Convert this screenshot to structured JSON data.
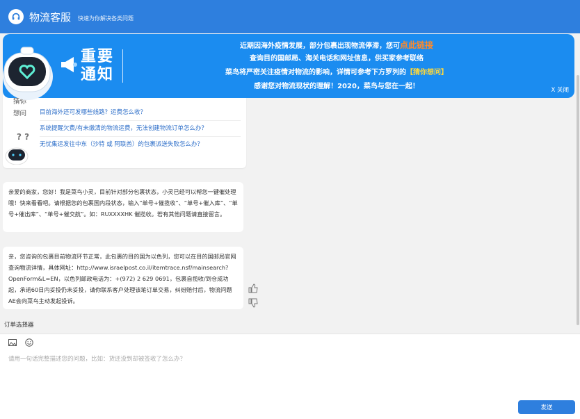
{
  "header": {
    "title": "物流客服",
    "subtitle": "快速为你解决各类问题"
  },
  "banner": {
    "heading_line1": "重要",
    "heading_line2": "通知",
    "line1_prefix": "近期因海外疫情发展，部分包裹出现物流停滞，您可",
    "line1_link": "点此链接",
    "line2": "查询目的国邮局、海关电话和网址信息，供买家参考联络",
    "line3_prefix": "菜鸟将严密关注疫情对物流的影响，详情可参考下方罗列的",
    "line3_link": "【猜你想问】",
    "line4": "感谢您对物流现状的理解！2020，菜鸟与您在一起！",
    "close_label": "X 关闭"
  },
  "faq": {
    "side_label_1": "猜你",
    "side_label_2": "想问",
    "questions": [
      "目前海外还可发哪些线路？运费怎么收？",
      "系统提醒欠费/有未缴清的物流运费，无法创建物流订单怎么办？",
      "无忧集运发往中东（沙特 或 阿联酋）的包裹派送失败怎么办？"
    ]
  },
  "messages": [
    "亲爱的商家，您好！我是菜鸟小灵，目前针对部分包裹状态，小灵已经可以帮您一键催处理哦！快来看看吧。请根据您的包裹国内段状态，输入“单号+催揽收”、“单号+催入库”、“单号+催出库”、“单号+催交航”。如：RUXXXXHK 催揽收。若有其他问题请直接留言。",
    "亲，您咨询的包裹目前物流环节正常，此包裹的目的国为以色列，您可以在目的国邮局官网查询物流详情，具体网址：http://www.israelpost.co.il/itemtrace.nsf/mainsearch?OpenForm&L=EN，以色列邮政电话为：+(972) 2 629 0691，包裹自揽收/到仓成功起，承诺60日内妥投仍未妥投，请你联系客户处理该笔订单交易，纠纷赔付后，物流问题AE会向菜鸟主动发起投诉。"
  ],
  "order_selector": "订单选择器",
  "input": {
    "placeholder": "请用一句话完整描述您的问题，比如：货还没到却被签收了怎么办？"
  },
  "send_label": "发送",
  "colors": {
    "primary": "#2e7fde",
    "banner": "#1b8cf0",
    "highlight": "#ff8a2a",
    "link": "#2e6fc9"
  }
}
